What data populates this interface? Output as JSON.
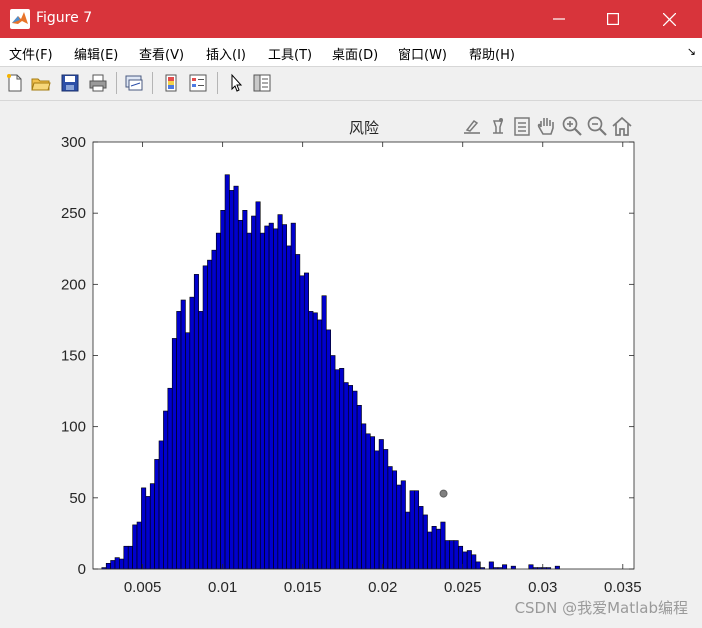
{
  "window": {
    "title": "Figure 7"
  },
  "menu": {
    "items": [
      {
        "label": "文件(F)"
      },
      {
        "label": "编辑(E)"
      },
      {
        "label": "查看(V)"
      },
      {
        "label": "插入(I)"
      },
      {
        "label": "工具(T)"
      },
      {
        "label": "桌面(D)"
      },
      {
        "label": "窗口(W)"
      },
      {
        "label": "帮助(H)"
      }
    ],
    "overflow_icon": "dock-arrow-icon"
  },
  "toolbar": {
    "icons": [
      "new-figure-icon",
      "open-file-icon",
      "save-icon",
      "print-icon",
      "link-plot-icon",
      "insert-colorbar-icon",
      "insert-legend-icon",
      "edit-plot-icon",
      "property-inspector-icon"
    ]
  },
  "axes_toolbar": {
    "icons": [
      "brush-icon",
      "data-cursor-icon",
      "pan-save-icon",
      "pan-icon",
      "zoom-in-icon",
      "zoom-out-icon",
      "home-icon"
    ]
  },
  "colors": {
    "bar_fill": "#0000cd",
    "bar_edge": "#000000",
    "titlebar": "#d8343b"
  },
  "watermark": "CSDN @我爱Matlab编程",
  "chart_data": {
    "type": "bar",
    "title": "风险",
    "xlabel": "",
    "ylabel": "",
    "xlim": [
      0.0019,
      0.0357
    ],
    "ylim": [
      0,
      300
    ],
    "xticks": [
      0.005,
      0.01,
      0.015,
      0.02,
      0.025,
      0.03,
      0.035
    ],
    "xtick_labels": [
      "0.005",
      "0.01",
      "0.015",
      "0.02",
      "0.025",
      "0.03",
      "0.035"
    ],
    "yticks": [
      0,
      50,
      100,
      150,
      200,
      250,
      300
    ],
    "ytick_labels": [
      "0",
      "50",
      "100",
      "150",
      "200",
      "250",
      "300"
    ],
    "bin_start": 0.0019,
    "bin_width": 0.000275,
    "values": [
      0,
      0,
      1,
      4,
      6,
      8,
      7,
      16,
      16,
      31,
      33,
      57,
      51,
      60,
      77,
      90,
      111,
      127,
      162,
      181,
      189,
      166,
      191,
      207,
      181,
      213,
      217,
      224,
      236,
      252,
      277,
      266,
      269,
      245,
      252,
      236,
      248,
      258,
      236,
      241,
      243,
      239,
      249,
      242,
      227,
      243,
      221,
      206,
      208,
      181,
      180,
      175,
      192,
      168,
      150,
      140,
      141,
      131,
      129,
      125,
      115,
      102,
      95,
      93,
      83,
      91,
      84,
      72,
      69,
      59,
      62,
      40,
      55,
      55,
      44,
      38,
      26,
      30,
      28,
      33,
      20,
      20,
      20,
      16,
      12,
      13,
      10,
      5,
      1,
      0,
      5,
      1,
      1,
      3,
      0,
      2,
      0,
      0,
      0,
      3,
      1,
      1,
      1,
      1,
      0,
      2,
      0
    ],
    "marker": {
      "x": 0.0238,
      "y": 53
    }
  }
}
